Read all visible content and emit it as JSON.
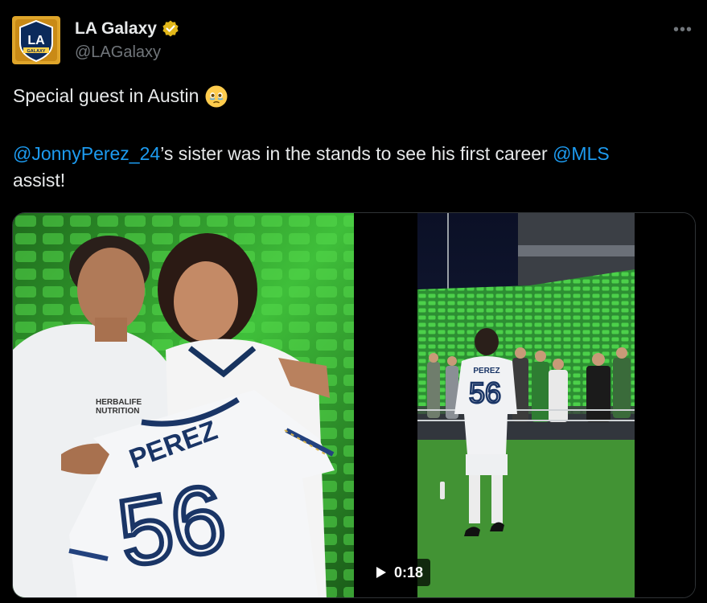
{
  "tweet": {
    "author": {
      "display_name": "LA Galaxy",
      "handle": "@LAGalaxy",
      "avatar_text": "LA",
      "avatar_badge": "GALAXY"
    },
    "more_label": "•••",
    "text_line1": "Special guest in Austin",
    "emoji": "face-holding-back-tears",
    "mention1": "@JonnyPerez_24",
    "text_mid": "’s sister was in the stands to see his first career ",
    "mention2": "@MLS",
    "text_end": "assist!"
  },
  "media": {
    "photo": {
      "shirt_name": "PEREZ",
      "shirt_number": "56",
      "sponsor_line1": "HERBALIFE",
      "sponsor_line2": "NUTRITION"
    },
    "video": {
      "shirt_name": "PEREZ",
      "shirt_number": "56",
      "duration": "0:18"
    }
  },
  "colors": {
    "background": "#000000",
    "text": "#e7e9ea",
    "secondary": "#71767b",
    "link": "#1d9bf0",
    "verified_gold": "#e2b719",
    "stadium_green": "#3fbf3a"
  }
}
